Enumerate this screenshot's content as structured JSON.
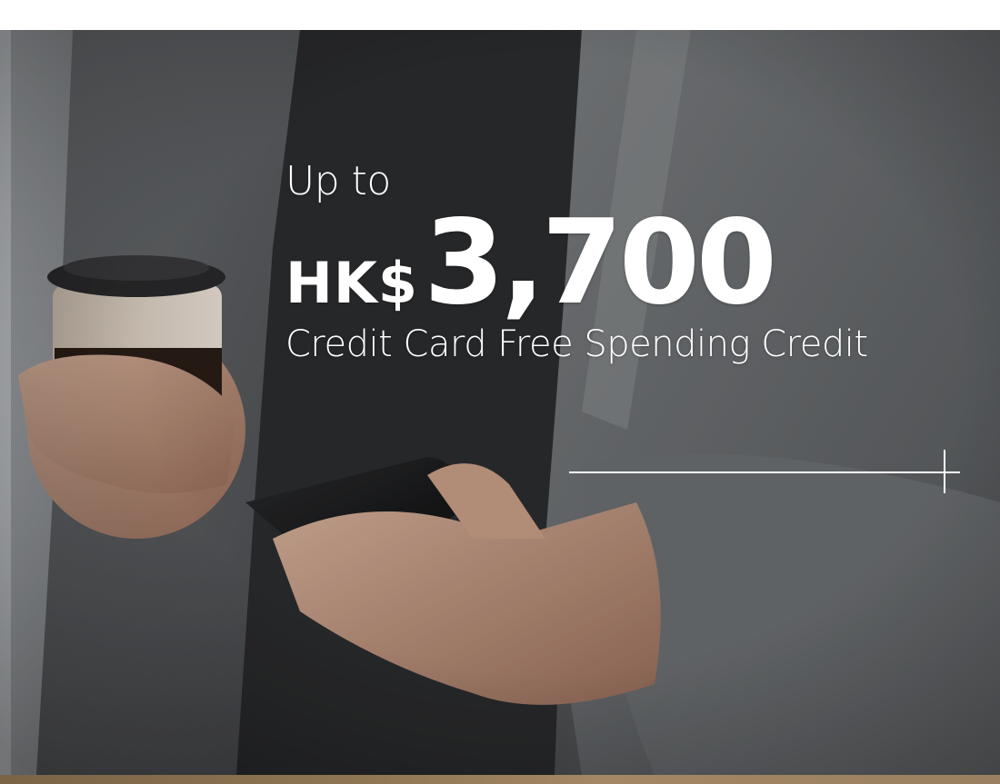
{
  "promo": {
    "line1": "Up to",
    "currency": "HK$",
    "amount": "3,700",
    "line3": "Credit Card Free Spending Credit"
  },
  "colors": {
    "text": "#ffffff",
    "bottom_strip": "#8e7552"
  }
}
